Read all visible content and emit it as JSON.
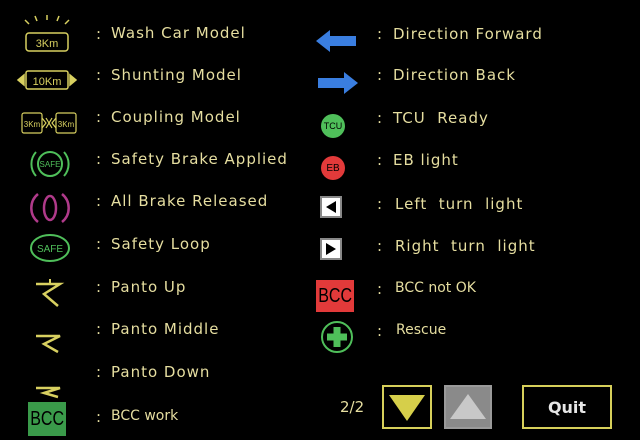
{
  "left_items": [
    {
      "icon": "wash-car-3km-icon",
      "icon_text": "3Km",
      "label": "Wash Car Model"
    },
    {
      "icon": "shunting-10km-icon",
      "icon_text": "10Km",
      "label": "Shunting Model"
    },
    {
      "icon": "coupling-3km-icon",
      "icon_text": "3Km",
      "label": "Coupling Model"
    },
    {
      "icon": "safety-brake-applied-icon",
      "icon_text": "SAFE",
      "label": "Safety Brake Applied"
    },
    {
      "icon": "all-brake-released-icon",
      "icon_text": "",
      "label": "All Brake Released"
    },
    {
      "icon": "safety-loop-icon",
      "icon_text": "SAFE",
      "label": "Safety Loop"
    },
    {
      "icon": "panto-up-icon",
      "icon_text": "",
      "label": "Panto Up"
    },
    {
      "icon": "panto-middle-icon",
      "icon_text": "",
      "label": "Panto Middle"
    },
    {
      "icon": "panto-down-icon",
      "icon_text": "",
      "label": "Panto Down"
    },
    {
      "icon": "bcc-work-icon",
      "icon_text": "BCC",
      "label": "BCC work"
    }
  ],
  "right_items": [
    {
      "icon": "direction-forward-arrow-icon",
      "icon_text": "",
      "label": "Direction Forward"
    },
    {
      "icon": "direction-back-arrow-icon",
      "icon_text": "",
      "label": "Direction Back"
    },
    {
      "icon": "tcu-ready-icon",
      "icon_text": "TCU",
      "label": "TCU  Ready"
    },
    {
      "icon": "eb-light-icon",
      "icon_text": "EB",
      "label": "EB light"
    },
    {
      "icon": "left-turn-light-icon",
      "icon_text": "",
      "label": "Left  turn  light"
    },
    {
      "icon": "right-turn-light-icon",
      "icon_text": "",
      "label": "Right  turn  light"
    },
    {
      "icon": "bcc-not-ok-icon",
      "icon_text": "BCC",
      "label": "BCC not OK"
    },
    {
      "icon": "rescue-cross-icon",
      "icon_text": "",
      "label": "Rescue"
    }
  ],
  "colon": ":",
  "pager": {
    "page": "2/2"
  },
  "quit_label": "Quit",
  "colors": {
    "text": "#e6dea0",
    "icon_yellow": "#d8d060",
    "arrow_blue": "#3a7ee0",
    "green": "#4fbf5a",
    "red": "#e23a3a"
  }
}
